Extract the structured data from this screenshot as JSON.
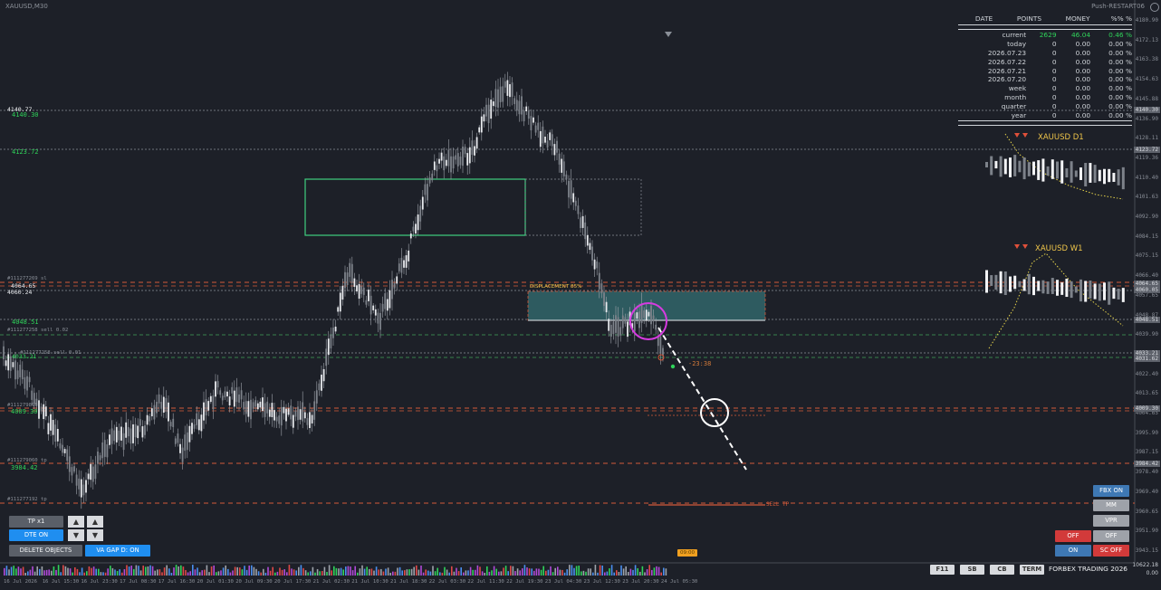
{
  "window": {
    "symbol_title": "XAUUSD,M30",
    "push_label": "Push-RESTART06"
  },
  "stats": {
    "headers": [
      "DATE",
      "POINTS",
      "MONEY",
      "%% %"
    ],
    "rows": [
      {
        "label": "current",
        "points": "2629",
        "money": "46.04",
        "pct": "0.46 %",
        "highlight": true
      },
      {
        "label": "today",
        "points": "0",
        "money": "0.00",
        "pct": "0.00 %"
      },
      {
        "label": "2026.07.23",
        "points": "0",
        "money": "0.00",
        "pct": "0.00 %"
      },
      {
        "label": "2026.07.22",
        "points": "0",
        "money": "0.00",
        "pct": "0.00 %"
      },
      {
        "label": "2026.07.21",
        "points": "0",
        "money": "0.00",
        "pct": "0.00 %"
      },
      {
        "label": "2026.07.20",
        "points": "0",
        "money": "0.00",
        "pct": "0.00 %"
      },
      {
        "label": "week",
        "points": "0",
        "money": "0.00",
        "pct": "0.00 %"
      },
      {
        "label": "month",
        "points": "0",
        "money": "0.00",
        "pct": "0.00 %"
      },
      {
        "label": "quarter",
        "points": "0",
        "money": "0.00",
        "pct": "0.00 %"
      },
      {
        "label": "year",
        "points": "0",
        "money": "0.00",
        "pct": "0.00 %"
      }
    ]
  },
  "price_axis": {
    "ticks": [
      "4180.90",
      "4172.13",
      "4163.38",
      "4154.63",
      "4145.88",
      "4136.90",
      "4128.11",
      "4119.36",
      "4110.40",
      "4101.63",
      "4092.90",
      "4084.15",
      "4075.15",
      "4066.40",
      "4057.65",
      "4048.87",
      "4039.90",
      "4031.15",
      "4022.40",
      "4013.65",
      "4004.65",
      "3995.90",
      "3987.15",
      "3978.40",
      "3969.40",
      "3960.65",
      "3951.90",
      "3943.15"
    ],
    "boxes": [
      "4140.30",
      "4123.72",
      "4064.65",
      "4060.05",
      "4048.51",
      "4033.21",
      "4031.62",
      "4009.30",
      "3984.42"
    ],
    "bottom_value": "10622.18",
    "bottom_value2": "0.00"
  },
  "time_axis": [
    "16 Jul 2026",
    "16 Jul 15:30",
    "16 Jul 23:30",
    "17 Jul 08:30",
    "17 Jul 16:30",
    "20 Jul 01:30",
    "20 Jul 09:30",
    "20 Jul 17:30",
    "21 Jul 02:30",
    "21 Jul 10:30",
    "21 Jul 18:30",
    "22 Jul 03:30",
    "22 Jul 11:30",
    "22 Jul 19:30",
    "23 Jul 04:30",
    "23 Jul 12:30",
    "23 Jul 20:30",
    "24 Jul 05:30"
  ],
  "left_levels": {
    "l1": "4140.77",
    "l2": "4140.30",
    "l3": "4123.72",
    "l4": "#111277269 sl",
    "l5": "4064.65",
    "l6": "4060.24",
    "l7": "4048.51",
    "l8": "#111277258 sell 0.02",
    "l9": "4033.21",
    "l10": "#111277258 sell 0.01",
    "l11": "#111279898",
    "l12": "4009.30",
    "l13": "#111279060 tp",
    "l14": "3984.42",
    "l15": "#111277192 tp"
  },
  "annotations": {
    "displacement": "DISPLACEMENT 85%",
    "countdown": "-23:38",
    "sell_tp": "SELL TP",
    "info_chip": "09:00"
  },
  "mtf": {
    "d1_title": "XAUUSD D1",
    "w1_title": "XAUUSD W1"
  },
  "left_panel": {
    "tp": "TP x1",
    "dte": "DTE ON",
    "delete": "DELETE OBJECTS",
    "vagap": "VA GAP D: ON",
    "up": "▲",
    "down": "▼"
  },
  "right_panel": {
    "fbx": "FBX ON",
    "mm": "MM",
    "vpr": "VPR",
    "off_red": "OFF",
    "off_gray": "OFF",
    "on": "ON",
    "sc": "SC OFF"
  },
  "bottom_buttons": [
    "F11",
    "SB",
    "CB",
    "TERM"
  ],
  "footer_brand": "FORBEX TRADING 2026",
  "colors": {
    "bg": "#1d2028",
    "green_box": "#3fcf7f",
    "teal_zone": "#2e5b60",
    "red_dash": "#d35a3a",
    "gold": "#f0c64a"
  }
}
